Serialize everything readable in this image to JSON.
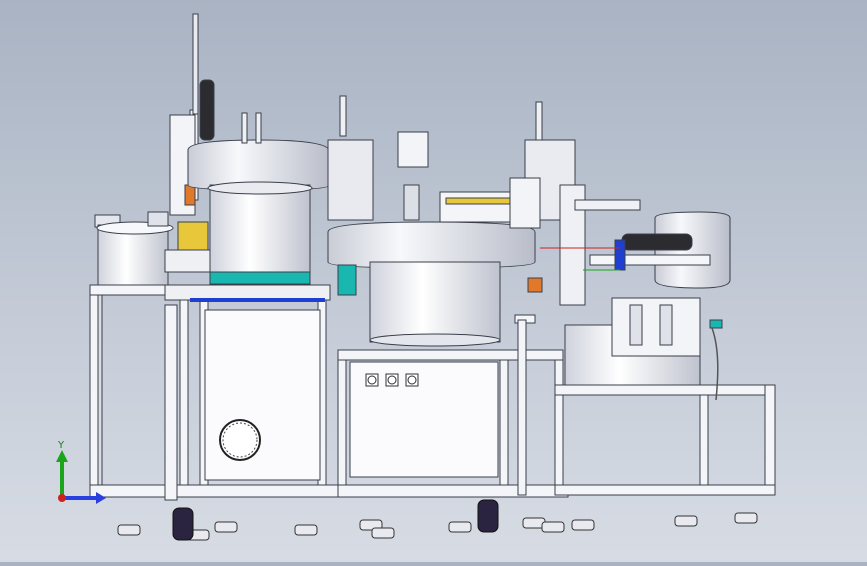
{
  "viewport": {
    "background_top": "#a9b3c3",
    "background_bottom": "#d7dce4",
    "model": {
      "frame_color": "#f4f5f8",
      "frame_edge": "#3a3f4a",
      "bowl_color": "#f0f2f6",
      "accent_blue": "#1f3fd0",
      "accent_teal": "#19b7b0",
      "accent_yellow": "#e8c83a",
      "accent_orange": "#e07a2a",
      "caster_color": "#2a2440"
    }
  },
  "triad": {
    "y_label": "Y",
    "y_color": "#1aa51a",
    "x_color": "#2a3fe0",
    "z_color": "#d02020"
  }
}
